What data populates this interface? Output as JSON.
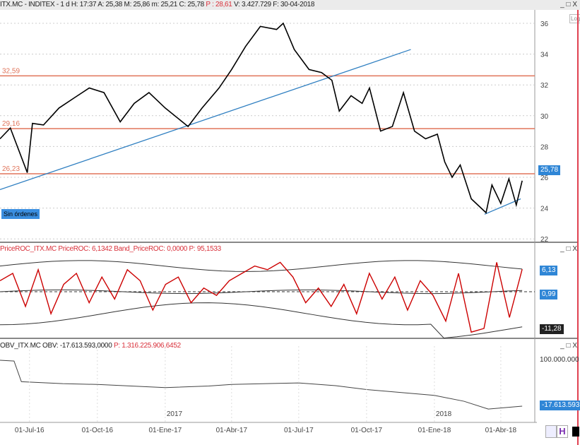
{
  "main_header": {
    "prefix": "ITX.MC - INDITEX - 1 d H: 17:37 A: 25,38 M: 25,86 m: 25,21 C: 25,78 ",
    "p": "P : 28,61",
    "suffix": " V: 3.427.729 F: 30-04-2018"
  },
  "roc_header": {
    "text": "PriceROC_ITX.MC PriceROC: 6,1342 Band_PriceROC: 0,0000 ",
    "p": "P: 95,1533"
  },
  "obv_header": {
    "text": "OBV_ITX.MC OBV: -17.613.593,0000 ",
    "p": "P: 1.316.225.906,6452"
  },
  "window_controls": "_ □ X",
  "log_button": "Log",
  "orders_label": "Sin órdenes",
  "price_badge": "25,78",
  "roc_badges": {
    "upper": "6,13",
    "mid": "0,99",
    "lower": "-11,28"
  },
  "obv_badges": {
    "top": "100.000.000",
    "current": "-17.613.593"
  },
  "colors": {
    "price": "#000000",
    "hline": "#e0745a",
    "trend": "#2f7fc1",
    "roc": "#cc0000",
    "band": "#333333",
    "badge": "#2f86d6"
  },
  "chart_data": [
    {
      "type": "line",
      "title": "ITX.MC - INDITEX",
      "ylim": [
        22,
        36
      ],
      "yticks": [
        22,
        24,
        26,
        28,
        30,
        32,
        34,
        36
      ],
      "horizontal_levels": [
        {
          "label": "32,59",
          "value": 32.59
        },
        {
          "label": "29,16",
          "value": 29.16
        },
        {
          "label": "26,23",
          "value": 26.23
        }
      ],
      "trendlines": [
        {
          "from": [
            "2016-05-22",
            25.2
          ],
          "to": [
            "2017-11-30",
            34.3
          ]
        },
        {
          "from": [
            "2018-03-10",
            23.6
          ],
          "to": [
            "2018-04-28",
            24.6
          ]
        }
      ],
      "x": [
        "2016-05-22",
        "2016-06-05",
        "2016-06-28",
        "2016-07-05",
        "2016-07-20",
        "2016-08-10",
        "2016-09-01",
        "2016-09-20",
        "2016-10-10",
        "2016-11-01",
        "2016-11-20",
        "2016-12-10",
        "2017-01-01",
        "2017-02-01",
        "2017-02-20",
        "2017-03-15",
        "2017-04-01",
        "2017-04-20",
        "2017-05-10",
        "2017-06-01",
        "2017-06-10",
        "2017-06-25",
        "2017-07-15",
        "2017-08-01",
        "2017-08-15",
        "2017-08-25",
        "2017-09-10",
        "2017-09-25",
        "2017-10-05",
        "2017-10-20",
        "2017-11-05",
        "2017-11-20",
        "2017-12-05",
        "2017-12-20",
        "2018-01-05",
        "2018-01-15",
        "2018-01-25",
        "2018-02-05",
        "2018-02-20",
        "2018-03-12",
        "2018-03-20",
        "2018-04-01",
        "2018-04-12",
        "2018-04-22",
        "2018-04-30"
      ],
      "values": [
        28.5,
        29.2,
        26.3,
        29.5,
        29.4,
        30.5,
        31.2,
        31.8,
        31.5,
        29.6,
        30.8,
        31.5,
        30.5,
        29.3,
        30.5,
        31.8,
        33.0,
        34.5,
        35.8,
        35.6,
        36.0,
        34.3,
        33.0,
        32.8,
        32.3,
        30.3,
        31.3,
        30.8,
        31.8,
        29.0,
        29.3,
        31.5,
        29.0,
        28.5,
        28.8,
        27.0,
        26.0,
        26.8,
        24.6,
        23.7,
        25.5,
        24.3,
        25.9,
        24.2,
        25.78
      ]
    },
    {
      "type": "line",
      "series": [
        {
          "name": "PriceROC",
          "values": [
            3,
            5,
            -4,
            6,
            -6,
            2,
            5,
            -3,
            4,
            -2,
            6,
            3,
            -5,
            2,
            4,
            -3,
            1,
            -1,
            3,
            5,
            7,
            6,
            8,
            4,
            -3,
            1,
            -4,
            2,
            -6,
            5,
            -2,
            4,
            -5,
            3,
            -1,
            -8,
            5,
            -11,
            -10,
            8,
            -7,
            6.13
          ]
        },
        {
          "name": "Band_PriceROC",
          "values": [
            0
          ]
        }
      ],
      "ylim": [
        -13,
        9
      ],
      "x_range": [
        "2016-05-22",
        "2018-04-30"
      ]
    },
    {
      "type": "line",
      "series": [
        {
          "name": "OBV",
          "values": [
            100,
            98,
            45,
            40,
            38,
            30,
            34,
            38,
            42,
            35,
            25,
            10,
            -5,
            -25,
            -17.6135
          ]
        }
      ],
      "unit": "millions",
      "x": [
        "2016-05-22",
        "2016-06-10",
        "2016-06-20",
        "2016-08-15",
        "2016-10-01",
        "2017-01-01",
        "2017-03-01",
        "2017-04-01",
        "2017-07-01",
        "2017-08-20",
        "2017-10-01",
        "2018-01-01",
        "2018-02-10",
        "2018-03-15",
        "2018-04-30"
      ]
    }
  ],
  "x_axis": {
    "ticks": [
      "01-Jul-16",
      "01-Oct-16",
      "01-Ene-17",
      "01-Abr-17",
      "01-Jul-17",
      "01-Oct-17",
      "01-Ene-18",
      "01-Abr-18"
    ],
    "years": [
      "2017",
      "2018"
    ]
  }
}
